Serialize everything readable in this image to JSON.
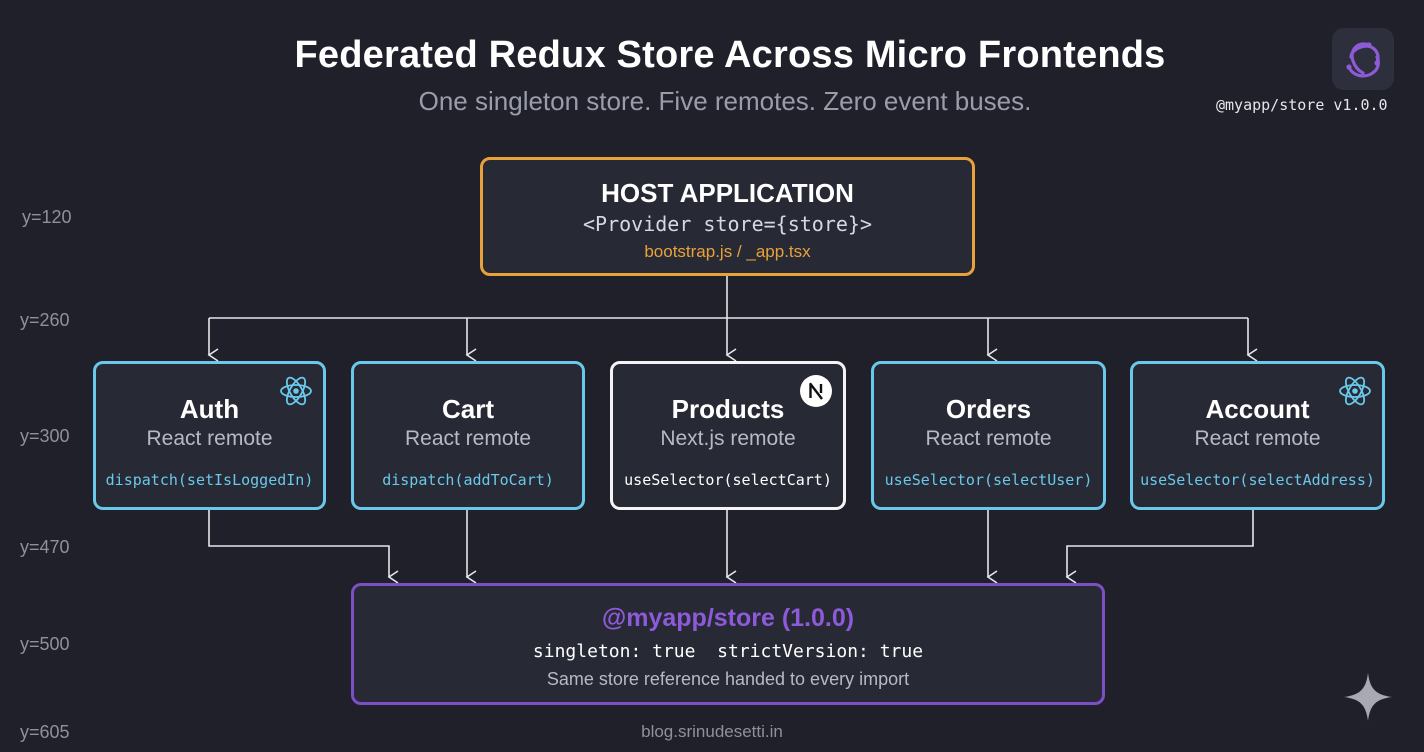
{
  "header": {
    "title": "Federated Redux Store Across Micro Frontends",
    "subtitle": "One singleton store. Five remotes. Zero event buses.",
    "version": "@myapp/store v1.0.0"
  },
  "y_markers": [
    "y=120",
    "y=260",
    "y=300",
    "y=470",
    "y=500",
    "y=605"
  ],
  "host": {
    "title": "HOST APPLICATION",
    "code": "<Provider store={store}>",
    "file": "bootstrap.js / _app.tsx"
  },
  "remotes": [
    {
      "name": "Auth",
      "type": "React remote",
      "call": "dispatch(setIsLoggedIn)",
      "icon": "react-icon"
    },
    {
      "name": "Cart",
      "type": "React remote",
      "call": "dispatch(addToCart)",
      "icon": ""
    },
    {
      "name": "Products",
      "type": "Next.js remote",
      "call": "useSelector(selectCart)",
      "icon": "nextjs-icon"
    },
    {
      "name": "Orders",
      "type": "React remote",
      "call": "useSelector(selectUser)",
      "icon": ""
    },
    {
      "name": "Account",
      "type": "React remote",
      "call": "useSelector(selectAddress)",
      "icon": "react-icon"
    }
  ],
  "store": {
    "title": "@myapp/store (1.0.0)",
    "config": "singleton: true  strictVersion: true",
    "note": "Same store reference handed to every import"
  },
  "footer": "blog.srinudesetti.in",
  "colors": {
    "background": "#1f2029",
    "host_border": "#e9a23b",
    "react_border": "#6ac8ea",
    "next_border": "#f4f4f6",
    "store_border": "#7c4fc4",
    "store_title": "#8d5ad9"
  }
}
